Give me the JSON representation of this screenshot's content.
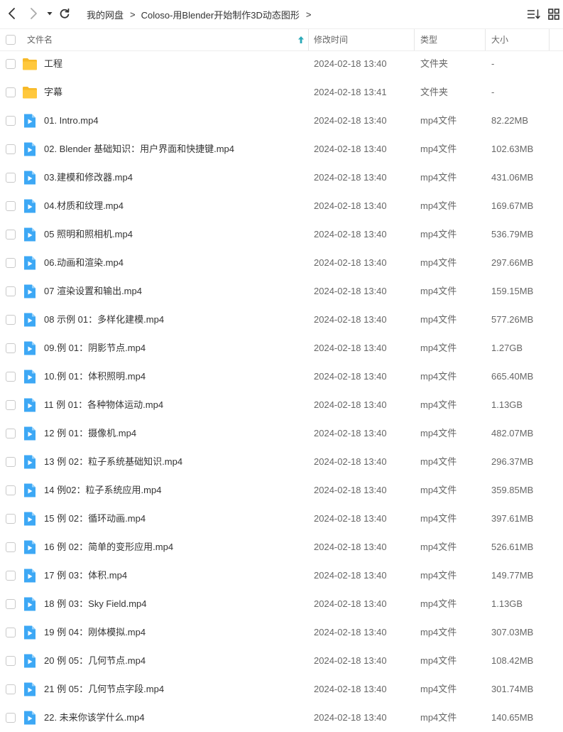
{
  "toolbar": {
    "breadcrumb": [
      "我的网盘",
      "Coloso-用Blender开始制作3D动态图形"
    ]
  },
  "header": {
    "name": "文件名",
    "modified": "修改时间",
    "type": "类型",
    "size": "大小"
  },
  "files": [
    {
      "name": "工程",
      "date": "2024-02-18 13:40",
      "type": "文件夹",
      "size": "-",
      "kind": "folder"
    },
    {
      "name": "字幕",
      "date": "2024-02-18 13:41",
      "type": "文件夹",
      "size": "-",
      "kind": "folder"
    },
    {
      "name": "01. Intro.mp4",
      "date": "2024-02-18 13:40",
      "type": "mp4文件",
      "size": "82.22MB",
      "kind": "video"
    },
    {
      "name": "02. Blender 基础知识：用户界面和快捷键.mp4",
      "date": "2024-02-18 13:40",
      "type": "mp4文件",
      "size": "102.63MB",
      "kind": "video"
    },
    {
      "name": "03.建模和修改器.mp4",
      "date": "2024-02-18 13:40",
      "type": "mp4文件",
      "size": "431.06MB",
      "kind": "video"
    },
    {
      "name": "04.材质和纹理.mp4",
      "date": "2024-02-18 13:40",
      "type": "mp4文件",
      "size": "169.67MB",
      "kind": "video"
    },
    {
      "name": "05 照明和照相机.mp4",
      "date": "2024-02-18 13:40",
      "type": "mp4文件",
      "size": "536.79MB",
      "kind": "video"
    },
    {
      "name": "06.动画和渲染.mp4",
      "date": "2024-02-18 13:40",
      "type": "mp4文件",
      "size": "297.66MB",
      "kind": "video"
    },
    {
      "name": "07 渲染设置和输出.mp4",
      "date": "2024-02-18 13:40",
      "type": "mp4文件",
      "size": "159.15MB",
      "kind": "video"
    },
    {
      "name": "08 示例 01：多样化建模.mp4",
      "date": "2024-02-18 13:40",
      "type": "mp4文件",
      "size": "577.26MB",
      "kind": "video"
    },
    {
      "name": "09.例 01：阴影节点.mp4",
      "date": "2024-02-18 13:40",
      "type": "mp4文件",
      "size": "1.27GB",
      "kind": "video"
    },
    {
      "name": "10.例 01：体积照明.mp4",
      "date": "2024-02-18 13:40",
      "type": "mp4文件",
      "size": "665.40MB",
      "kind": "video"
    },
    {
      "name": "11 例 01：各种物体运动.mp4",
      "date": "2024-02-18 13:40",
      "type": "mp4文件",
      "size": "1.13GB",
      "kind": "video"
    },
    {
      "name": "12 例 01：摄像机.mp4",
      "date": "2024-02-18 13:40",
      "type": "mp4文件",
      "size": "482.07MB",
      "kind": "video"
    },
    {
      "name": "13 例 02：粒子系统基础知识.mp4",
      "date": "2024-02-18 13:40",
      "type": "mp4文件",
      "size": "296.37MB",
      "kind": "video"
    },
    {
      "name": "14 例02：粒子系统应用.mp4",
      "date": "2024-02-18 13:40",
      "type": "mp4文件",
      "size": "359.85MB",
      "kind": "video"
    },
    {
      "name": "15 例 02：循环动画.mp4",
      "date": "2024-02-18 13:40",
      "type": "mp4文件",
      "size": "397.61MB",
      "kind": "video"
    },
    {
      "name": "16 例 02：简单的变形应用.mp4",
      "date": "2024-02-18 13:40",
      "type": "mp4文件",
      "size": "526.61MB",
      "kind": "video"
    },
    {
      "name": "17 例 03：体积.mp4",
      "date": "2024-02-18 13:40",
      "type": "mp4文件",
      "size": "149.77MB",
      "kind": "video"
    },
    {
      "name": "18 例 03：Sky Field.mp4",
      "date": "2024-02-18 13:40",
      "type": "mp4文件",
      "size": "1.13GB",
      "kind": "video"
    },
    {
      "name": "19 例 04：刚体模拟.mp4",
      "date": "2024-02-18 13:40",
      "type": "mp4文件",
      "size": "307.03MB",
      "kind": "video"
    },
    {
      "name": "20 例 05：几何节点.mp4",
      "date": "2024-02-18 13:40",
      "type": "mp4文件",
      "size": "108.42MB",
      "kind": "video"
    },
    {
      "name": "21 例 05：几何节点字段.mp4",
      "date": "2024-02-18 13:40",
      "type": "mp4文件",
      "size": "301.74MB",
      "kind": "video"
    },
    {
      "name": "22. 未来你该学什么.mp4",
      "date": "2024-02-18 13:40",
      "type": "mp4文件",
      "size": "140.65MB",
      "kind": "video"
    }
  ],
  "colors": {
    "folder": "#FFC83D",
    "video": "#3DA8F5",
    "sort_arrow": "#2AA9B8"
  }
}
